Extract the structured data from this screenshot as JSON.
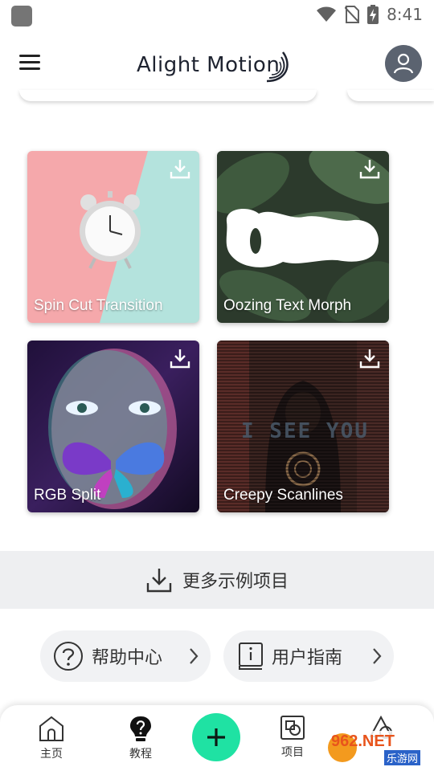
{
  "status_bar": {
    "time": "8:41"
  },
  "header": {
    "logo_text": "Alight Motion"
  },
  "samples": [
    {
      "title": "Spin Cut Transition"
    },
    {
      "title": "Oozing Text Morph",
      "overlay_text": "Ooze"
    },
    {
      "title": "RGB Split"
    },
    {
      "title": "Creepy Scanlines",
      "overlay_text": "I SEE YOU"
    }
  ],
  "more_examples": {
    "label": "更多示例项目"
  },
  "help_links": [
    {
      "label": "帮助中心"
    },
    {
      "label": "用户指南"
    }
  ],
  "bottom_nav": {
    "items": [
      {
        "label": "主页"
      },
      {
        "label": "教程"
      },
      {
        "label": "项目"
      }
    ]
  },
  "watermark": {
    "text": "962.NET",
    "subtext": "乐游网"
  },
  "colors": {
    "accent": "#1fe2a3",
    "avatar_bg": "#5b6370",
    "surface": "#eeeff1"
  }
}
